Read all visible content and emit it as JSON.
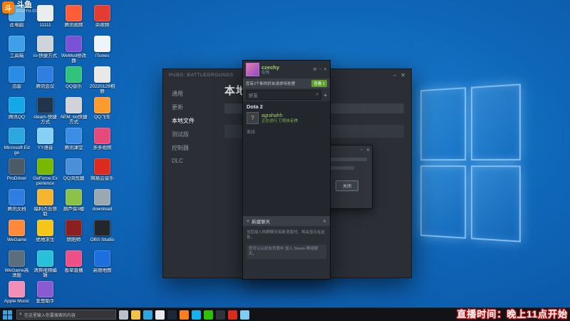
{
  "watermark": {
    "logo_char": "斗",
    "brand": "斗鱼",
    "domain": "DOUYU.COM"
  },
  "desktop_icons": [
    {
      "label": "此电脑",
      "color": "#5ab0e8"
    },
    {
      "label": "11111",
      "color": "#e9edf0"
    },
    {
      "label": "腾讯视频",
      "color": "#ff5c38"
    },
    {
      "label": "央视频",
      "color": "#e23d30"
    },
    {
      "label": "工具箱",
      "color": "#3f9fe8"
    },
    {
      "label": "io-快捷方式",
      "color": "#cdd5da"
    },
    {
      "label": "WeMod修改器",
      "color": "#7a52d6"
    },
    {
      "label": "iTunes",
      "color": "#eef4fa"
    },
    {
      "label": "迅雷",
      "color": "#2b8ce6"
    },
    {
      "label": "腾讯会议",
      "color": "#2f7fe0"
    },
    {
      "label": "QQ音乐",
      "color": "#31c27c"
    },
    {
      "label": "20220129相册",
      "color": "#e8e8e8"
    },
    {
      "label": "腾讯QQ",
      "color": "#15a8e8"
    },
    {
      "label": "steam-快捷方式",
      "color": "#20354c"
    },
    {
      "label": "AEM_bo快捷方式",
      "color": "#d0d4d8"
    },
    {
      "label": "QQ飞车",
      "color": "#ff9a2e"
    },
    {
      "label": "Microsoft Edge",
      "color": "#2da7e0"
    },
    {
      "label": "YY语音",
      "color": "#86d0f5"
    },
    {
      "label": "腾讯课堂",
      "color": "#3a8ee6"
    },
    {
      "label": "多多视频",
      "color": "#e64a7a"
    },
    {
      "label": "ProDriver",
      "color": "#4c5a66"
    },
    {
      "label": "GeForce Experience",
      "color": "#76b900"
    },
    {
      "label": "QQ浏览器",
      "color": "#4a90d9"
    },
    {
      "label": "网易云音乐",
      "color": "#dd2a1e"
    },
    {
      "label": "腾讯文档",
      "color": "#2f7de0"
    },
    {
      "label": "福利点击领取",
      "color": "#f5b52e"
    },
    {
      "label": "葫芦侠3楼",
      "color": "#8bc34a"
    },
    {
      "label": "download",
      "color": "#9aa8b2"
    },
    {
      "label": "WeGame",
      "color": "#ff8a3c"
    },
    {
      "label": "绝地求生",
      "color": "#f5c518"
    },
    {
      "label": "阴阳师",
      "color": "#8c1f1f"
    },
    {
      "label": "OBS Studio",
      "color": "#23272b"
    },
    {
      "label": "WeGame高清版",
      "color": "#5a6e7e"
    },
    {
      "label": "清爽视频编辑",
      "color": "#28c2d8"
    },
    {
      "label": "香草直播",
      "color": "#ee4f86"
    },
    {
      "label": "高德地图",
      "color": "#1d6fe0"
    },
    {
      "label": "Apple Music",
      "color": "#f090b8"
    },
    {
      "label": "爱思助手",
      "color": "#8a5ad0"
    }
  ],
  "steam": {
    "window_title": "PUBG: BATTLEGROUNDS",
    "minimize_glyph": "–",
    "close_glyph": "✕",
    "nav": [
      {
        "label": "通用",
        "color": "#8f98a0"
      },
      {
        "label": "更新",
        "color": "#8f98a0"
      },
      {
        "label": "本地文件",
        "color": "#ffffff"
      },
      {
        "label": "测试版",
        "color": "#8f98a0"
      },
      {
        "label": "控制器",
        "color": "#8f98a0"
      },
      {
        "label": "DLC",
        "color": "#8f98a0"
      }
    ],
    "heading": "本地文件",
    "dialog": {
      "minimize": "–",
      "close": "✕",
      "button": "关闭"
    }
  },
  "friends": {
    "username": "czechy",
    "user_status": "在线",
    "controls": {
      "settings": "⚙",
      "minimize": "–",
      "close": "✕"
    },
    "banner": {
      "text": "您有2个新的好友请求待处理",
      "button": "查看 1"
    },
    "search": {
      "placeholder": "好友",
      "search_glyph": "⌕",
      "add_glyph": "+"
    },
    "group_label": "Dota 2",
    "friend": {
      "avatar_glyph": "?",
      "name": "agrahahh",
      "status": "正在进行 刀塔自走棋"
    },
    "offline_label": "离线",
    "new_chat": {
      "plus_glyph": "+",
      "label": "新建聊天",
      "close_glyph": "✕"
    },
    "hints": [
      "当您加入的群聊天有新消息时，将会显示在此处。",
      "您可以从好友列表中 加入 Steam 群组聊天。"
    ]
  },
  "taskbar": {
    "search_glyph": "⌕",
    "search_placeholder": "在这里输入你要搜索的内容",
    "icons": [
      {
        "name": "task-view-icon",
        "color": "#b9c2ca"
      },
      {
        "name": "file-explorer-icon",
        "color": "#f2c14a"
      },
      {
        "name": "edge-icon",
        "color": "#2da7e0"
      },
      {
        "name": "chrome-icon",
        "color": "#e8eaed"
      },
      {
        "name": "steam-icon",
        "color": "#1b2838"
      },
      {
        "name": "douyu-icon",
        "color": "#ff7f1e"
      },
      {
        "name": "qq-icon",
        "color": "#14b2f0"
      },
      {
        "name": "wechat-icon",
        "color": "#2dc100"
      },
      {
        "name": "obs-icon",
        "color": "#30343a"
      },
      {
        "name": "netease-music-icon",
        "color": "#dd2a1e"
      },
      {
        "name": "yy-icon",
        "color": "#7ecdf4"
      }
    ]
  },
  "stream_overlay": {
    "text": "直播时间：晚上11点开始"
  }
}
